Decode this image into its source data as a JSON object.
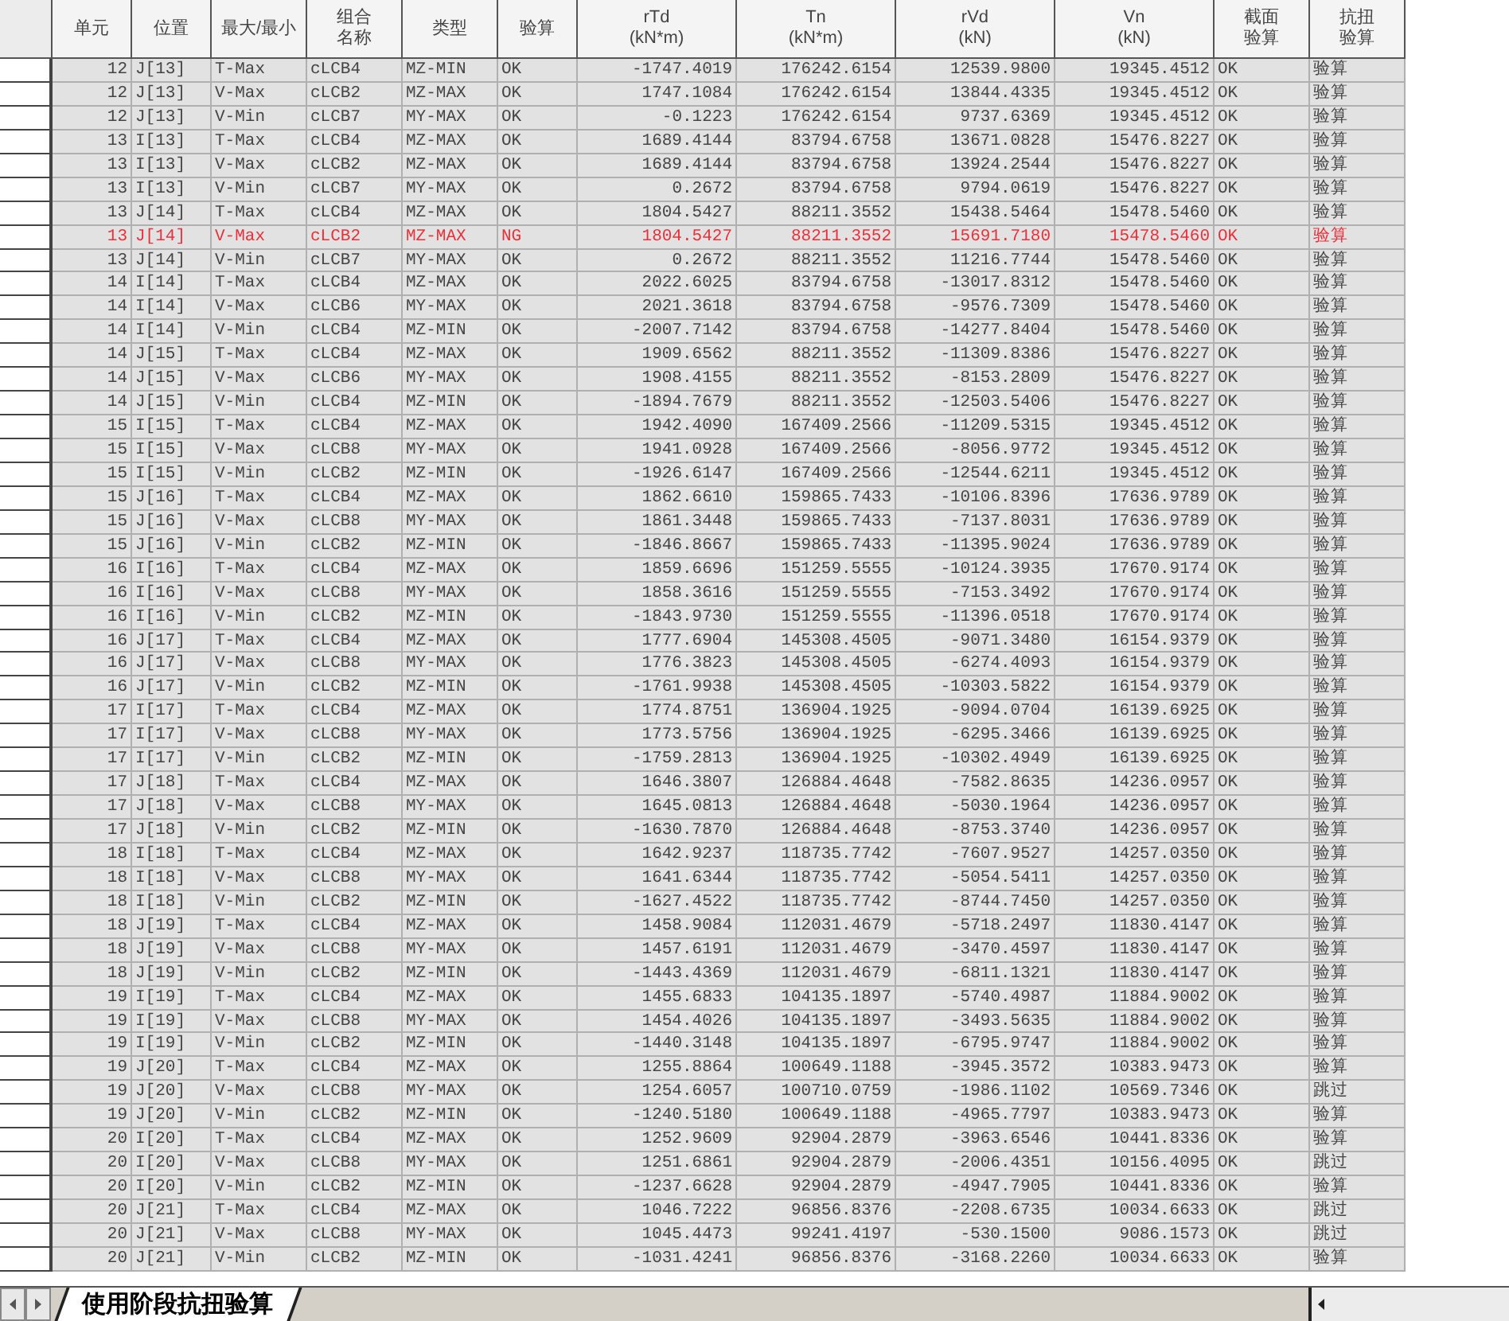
{
  "table": {
    "columns": [
      "单元",
      "位置",
      "最大/最小",
      "组合名称",
      "类型",
      "验算",
      "rTd (kN*m)",
      "Tn (kN*m)",
      "rVd (kN)",
      "Vn (kN)",
      "截面验算",
      "抗扭验算"
    ],
    "rows": [
      {
        "ng": false,
        "cells": [
          "12",
          "J[13]",
          "T-Max",
          "cLCB4",
          "MZ-MIN",
          "OK",
          "-1747.4019",
          "176242.6154",
          "12539.9800",
          "19345.4512",
          "OK",
          "验算"
        ]
      },
      {
        "ng": false,
        "cells": [
          "12",
          "J[13]",
          "V-Max",
          "cLCB2",
          "MZ-MAX",
          "OK",
          "1747.1084",
          "176242.6154",
          "13844.4335",
          "19345.4512",
          "OK",
          "验算"
        ]
      },
      {
        "ng": false,
        "cells": [
          "12",
          "J[13]",
          "V-Min",
          "cLCB7",
          "MY-MAX",
          "OK",
          "-0.1223",
          "176242.6154",
          "9737.6369",
          "19345.4512",
          "OK",
          "验算"
        ]
      },
      {
        "ng": false,
        "cells": [
          "13",
          "I[13]",
          "T-Max",
          "cLCB4",
          "MZ-MAX",
          "OK",
          "1689.4144",
          "83794.6758",
          "13671.0828",
          "15476.8227",
          "OK",
          "验算"
        ]
      },
      {
        "ng": false,
        "cells": [
          "13",
          "I[13]",
          "V-Max",
          "cLCB2",
          "MZ-MAX",
          "OK",
          "1689.4144",
          "83794.6758",
          "13924.2544",
          "15476.8227",
          "OK",
          "验算"
        ]
      },
      {
        "ng": false,
        "cells": [
          "13",
          "I[13]",
          "V-Min",
          "cLCB7",
          "MY-MAX",
          "OK",
          "0.2672",
          "83794.6758",
          "9794.0619",
          "15476.8227",
          "OK",
          "验算"
        ]
      },
      {
        "ng": false,
        "cells": [
          "13",
          "J[14]",
          "T-Max",
          "cLCB4",
          "MZ-MAX",
          "OK",
          "1804.5427",
          "88211.3552",
          "15438.5464",
          "15478.5460",
          "OK",
          "验算"
        ]
      },
      {
        "ng": true,
        "cells": [
          "13",
          "J[14]",
          "V-Max",
          "cLCB2",
          "MZ-MAX",
          "NG",
          "1804.5427",
          "88211.3552",
          "15691.7180",
          "15478.5460",
          "OK",
          "验算"
        ]
      },
      {
        "ng": false,
        "cells": [
          "13",
          "J[14]",
          "V-Min",
          "cLCB7",
          "MY-MAX",
          "OK",
          "0.2672",
          "88211.3552",
          "11216.7744",
          "15478.5460",
          "OK",
          "验算"
        ]
      },
      {
        "ng": false,
        "cells": [
          "14",
          "I[14]",
          "T-Max",
          "cLCB4",
          "MZ-MAX",
          "OK",
          "2022.6025",
          "83794.6758",
          "-13017.8312",
          "15478.5460",
          "OK",
          "验算"
        ]
      },
      {
        "ng": false,
        "cells": [
          "14",
          "I[14]",
          "V-Max",
          "cLCB6",
          "MY-MAX",
          "OK",
          "2021.3618",
          "83794.6758",
          "-9576.7309",
          "15478.5460",
          "OK",
          "验算"
        ]
      },
      {
        "ng": false,
        "cells": [
          "14",
          "I[14]",
          "V-Min",
          "cLCB4",
          "MZ-MIN",
          "OK",
          "-2007.7142",
          "83794.6758",
          "-14277.8404",
          "15478.5460",
          "OK",
          "验算"
        ]
      },
      {
        "ng": false,
        "cells": [
          "14",
          "J[15]",
          "T-Max",
          "cLCB4",
          "MZ-MAX",
          "OK",
          "1909.6562",
          "88211.3552",
          "-11309.8386",
          "15476.8227",
          "OK",
          "验算"
        ]
      },
      {
        "ng": false,
        "cells": [
          "14",
          "J[15]",
          "V-Max",
          "cLCB6",
          "MY-MAX",
          "OK",
          "1908.4155",
          "88211.3552",
          "-8153.2809",
          "15476.8227",
          "OK",
          "验算"
        ]
      },
      {
        "ng": false,
        "cells": [
          "14",
          "J[15]",
          "V-Min",
          "cLCB4",
          "MZ-MIN",
          "OK",
          "-1894.7679",
          "88211.3552",
          "-12503.5406",
          "15476.8227",
          "OK",
          "验算"
        ]
      },
      {
        "ng": false,
        "cells": [
          "15",
          "I[15]",
          "T-Max",
          "cLCB4",
          "MZ-MAX",
          "OK",
          "1942.4090",
          "167409.2566",
          "-11209.5315",
          "19345.4512",
          "OK",
          "验算"
        ]
      },
      {
        "ng": false,
        "cells": [
          "15",
          "I[15]",
          "V-Max",
          "cLCB8",
          "MY-MAX",
          "OK",
          "1941.0928",
          "167409.2566",
          "-8056.9772",
          "19345.4512",
          "OK",
          "验算"
        ]
      },
      {
        "ng": false,
        "cells": [
          "15",
          "I[15]",
          "V-Min",
          "cLCB2",
          "MZ-MIN",
          "OK",
          "-1926.6147",
          "167409.2566",
          "-12544.6211",
          "19345.4512",
          "OK",
          "验算"
        ]
      },
      {
        "ng": false,
        "cells": [
          "15",
          "J[16]",
          "T-Max",
          "cLCB4",
          "MZ-MAX",
          "OK",
          "1862.6610",
          "159865.7433",
          "-10106.8396",
          "17636.9789",
          "OK",
          "验算"
        ]
      },
      {
        "ng": false,
        "cells": [
          "15",
          "J[16]",
          "V-Max",
          "cLCB8",
          "MY-MAX",
          "OK",
          "1861.3448",
          "159865.7433",
          "-7137.8031",
          "17636.9789",
          "OK",
          "验算"
        ]
      },
      {
        "ng": false,
        "cells": [
          "15",
          "J[16]",
          "V-Min",
          "cLCB2",
          "MZ-MIN",
          "OK",
          "-1846.8667",
          "159865.7433",
          "-11395.9024",
          "17636.9789",
          "OK",
          "验算"
        ]
      },
      {
        "ng": false,
        "cells": [
          "16",
          "I[16]",
          "T-Max",
          "cLCB4",
          "MZ-MAX",
          "OK",
          "1859.6696",
          "151259.5555",
          "-10124.3935",
          "17670.9174",
          "OK",
          "验算"
        ]
      },
      {
        "ng": false,
        "cells": [
          "16",
          "I[16]",
          "V-Max",
          "cLCB8",
          "MY-MAX",
          "OK",
          "1858.3616",
          "151259.5555",
          "-7153.3492",
          "17670.9174",
          "OK",
          "验算"
        ]
      },
      {
        "ng": false,
        "cells": [
          "16",
          "I[16]",
          "V-Min",
          "cLCB2",
          "MZ-MIN",
          "OK",
          "-1843.9730",
          "151259.5555",
          "-11396.0518",
          "17670.9174",
          "OK",
          "验算"
        ]
      },
      {
        "ng": false,
        "cells": [
          "16",
          "J[17]",
          "T-Max",
          "cLCB4",
          "MZ-MAX",
          "OK",
          "1777.6904",
          "145308.4505",
          "-9071.3480",
          "16154.9379",
          "OK",
          "验算"
        ]
      },
      {
        "ng": false,
        "cells": [
          "16",
          "J[17]",
          "V-Max",
          "cLCB8",
          "MY-MAX",
          "OK",
          "1776.3823",
          "145308.4505",
          "-6274.4093",
          "16154.9379",
          "OK",
          "验算"
        ]
      },
      {
        "ng": false,
        "cells": [
          "16",
          "J[17]",
          "V-Min",
          "cLCB2",
          "MZ-MIN",
          "OK",
          "-1761.9938",
          "145308.4505",
          "-10303.5822",
          "16154.9379",
          "OK",
          "验算"
        ]
      },
      {
        "ng": false,
        "cells": [
          "17",
          "I[17]",
          "T-Max",
          "cLCB4",
          "MZ-MAX",
          "OK",
          "1774.8751",
          "136904.1925",
          "-9094.0704",
          "16139.6925",
          "OK",
          "验算"
        ]
      },
      {
        "ng": false,
        "cells": [
          "17",
          "I[17]",
          "V-Max",
          "cLCB8",
          "MY-MAX",
          "OK",
          "1773.5756",
          "136904.1925",
          "-6295.3466",
          "16139.6925",
          "OK",
          "验算"
        ]
      },
      {
        "ng": false,
        "cells": [
          "17",
          "I[17]",
          "V-Min",
          "cLCB2",
          "MZ-MIN",
          "OK",
          "-1759.2813",
          "136904.1925",
          "-10302.4949",
          "16139.6925",
          "OK",
          "验算"
        ]
      },
      {
        "ng": false,
        "cells": [
          "17",
          "J[18]",
          "T-Max",
          "cLCB4",
          "MZ-MAX",
          "OK",
          "1646.3807",
          "126884.4648",
          "-7582.8635",
          "14236.0957",
          "OK",
          "验算"
        ]
      },
      {
        "ng": false,
        "cells": [
          "17",
          "J[18]",
          "V-Max",
          "cLCB8",
          "MY-MAX",
          "OK",
          "1645.0813",
          "126884.4648",
          "-5030.1964",
          "14236.0957",
          "OK",
          "验算"
        ]
      },
      {
        "ng": false,
        "cells": [
          "17",
          "J[18]",
          "V-Min",
          "cLCB2",
          "MZ-MIN",
          "OK",
          "-1630.7870",
          "126884.4648",
          "-8753.3740",
          "14236.0957",
          "OK",
          "验算"
        ]
      },
      {
        "ng": false,
        "cells": [
          "18",
          "I[18]",
          "T-Max",
          "cLCB4",
          "MZ-MAX",
          "OK",
          "1642.9237",
          "118735.7742",
          "-7607.9527",
          "14257.0350",
          "OK",
          "验算"
        ]
      },
      {
        "ng": false,
        "cells": [
          "18",
          "I[18]",
          "V-Max",
          "cLCB8",
          "MY-MAX",
          "OK",
          "1641.6344",
          "118735.7742",
          "-5054.5411",
          "14257.0350",
          "OK",
          "验算"
        ]
      },
      {
        "ng": false,
        "cells": [
          "18",
          "I[18]",
          "V-Min",
          "cLCB2",
          "MZ-MIN",
          "OK",
          "-1627.4522",
          "118735.7742",
          "-8744.7450",
          "14257.0350",
          "OK",
          "验算"
        ]
      },
      {
        "ng": false,
        "cells": [
          "18",
          "J[19]",
          "T-Max",
          "cLCB4",
          "MZ-MAX",
          "OK",
          "1458.9084",
          "112031.4679",
          "-5718.2497",
          "11830.4147",
          "OK",
          "验算"
        ]
      },
      {
        "ng": false,
        "cells": [
          "18",
          "J[19]",
          "V-Max",
          "cLCB8",
          "MY-MAX",
          "OK",
          "1457.6191",
          "112031.4679",
          "-3470.4597",
          "11830.4147",
          "OK",
          "验算"
        ]
      },
      {
        "ng": false,
        "cells": [
          "18",
          "J[19]",
          "V-Min",
          "cLCB2",
          "MZ-MIN",
          "OK",
          "-1443.4369",
          "112031.4679",
          "-6811.1321",
          "11830.4147",
          "OK",
          "验算"
        ]
      },
      {
        "ng": false,
        "cells": [
          "19",
          "I[19]",
          "T-Max",
          "cLCB4",
          "MZ-MAX",
          "OK",
          "1455.6833",
          "104135.1897",
          "-5740.4987",
          "11884.9002",
          "OK",
          "验算"
        ]
      },
      {
        "ng": false,
        "cells": [
          "19",
          "I[19]",
          "V-Max",
          "cLCB8",
          "MY-MAX",
          "OK",
          "1454.4026",
          "104135.1897",
          "-3493.5635",
          "11884.9002",
          "OK",
          "验算"
        ]
      },
      {
        "ng": false,
        "cells": [
          "19",
          "I[19]",
          "V-Min",
          "cLCB2",
          "MZ-MIN",
          "OK",
          "-1440.3148",
          "104135.1897",
          "-6795.9747",
          "11884.9002",
          "OK",
          "验算"
        ]
      },
      {
        "ng": false,
        "cells": [
          "19",
          "J[20]",
          "T-Max",
          "cLCB4",
          "MZ-MAX",
          "OK",
          "1255.8864",
          "100649.1188",
          "-3945.3572",
          "10383.9473",
          "OK",
          "验算"
        ]
      },
      {
        "ng": false,
        "cells": [
          "19",
          "J[20]",
          "V-Max",
          "cLCB8",
          "MY-MAX",
          "OK",
          "1254.6057",
          "100710.0759",
          "-1986.1102",
          "10569.7346",
          "OK",
          "跳过"
        ]
      },
      {
        "ng": false,
        "cells": [
          "19",
          "J[20]",
          "V-Min",
          "cLCB2",
          "MZ-MIN",
          "OK",
          "-1240.5180",
          "100649.1188",
          "-4965.7797",
          "10383.9473",
          "OK",
          "验算"
        ]
      },
      {
        "ng": false,
        "cells": [
          "20",
          "I[20]",
          "T-Max",
          "cLCB4",
          "MZ-MAX",
          "OK",
          "1252.9609",
          "92904.2879",
          "-3963.6546",
          "10441.8336",
          "OK",
          "验算"
        ]
      },
      {
        "ng": false,
        "cells": [
          "20",
          "I[20]",
          "V-Max",
          "cLCB8",
          "MY-MAX",
          "OK",
          "1251.6861",
          "92904.2879",
          "-2006.4351",
          "10156.4095",
          "OK",
          "跳过"
        ]
      },
      {
        "ng": false,
        "cells": [
          "20",
          "I[20]",
          "V-Min",
          "cLCB2",
          "MZ-MIN",
          "OK",
          "-1237.6628",
          "92904.2879",
          "-4947.7905",
          "10441.8336",
          "OK",
          "验算"
        ]
      },
      {
        "ng": false,
        "cells": [
          "20",
          "J[21]",
          "T-Max",
          "cLCB4",
          "MZ-MAX",
          "OK",
          "1046.7222",
          "96856.8376",
          "-2208.6735",
          "10034.6633",
          "OK",
          "跳过"
        ]
      },
      {
        "ng": false,
        "cells": [
          "20",
          "J[21]",
          "V-Max",
          "cLCB8",
          "MY-MAX",
          "OK",
          "1045.4473",
          "99241.4197",
          "-530.1500",
          "9086.1573",
          "OK",
          "跳过"
        ]
      },
      {
        "ng": false,
        "cells": [
          "20",
          "J[21]",
          "V-Min",
          "cLCB2",
          "MZ-MIN",
          "OK",
          "-1031.4241",
          "96856.8376",
          "-3168.2260",
          "10034.6633",
          "OK",
          "验算"
        ]
      }
    ]
  },
  "sheet_tabs": [
    {
      "label": "使用阶段抗扭验算",
      "selected": true
    }
  ]
}
